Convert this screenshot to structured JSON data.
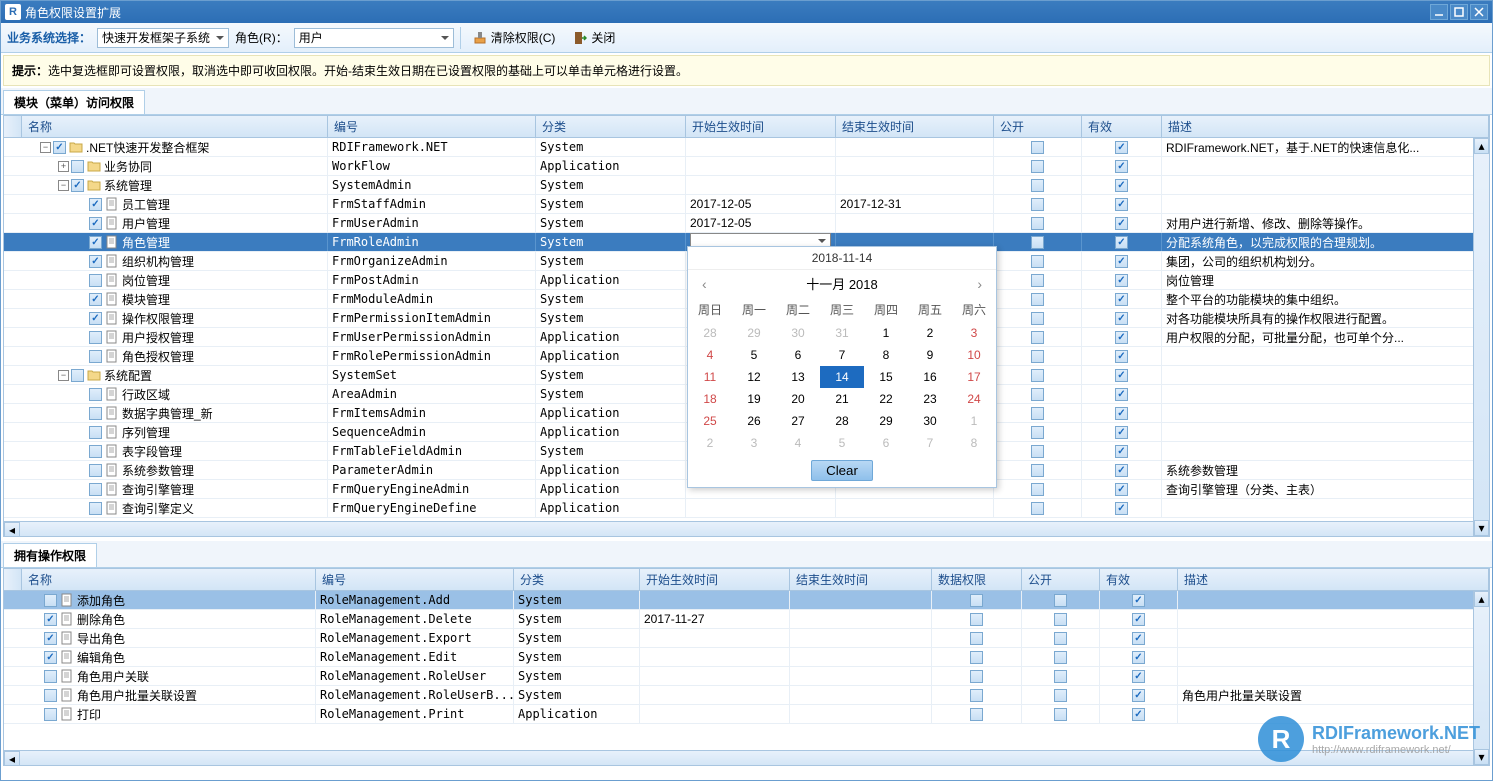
{
  "window": {
    "title": "角色权限设置扩展",
    "iconLetter": "R"
  },
  "toolbar": {
    "systemLabel": "业务系统选择：",
    "systemValue": "快速开发框架子系统",
    "roleLabel": "角色(R)：",
    "roleValue": "用户",
    "clearPerm": "清除权限(C)",
    "close": "关闭"
  },
  "tip": {
    "label": "提示：",
    "text": "选中复选框即可设置权限，取消选中即可收回权限。开始-结束生效日期在已设置权限的基础上可以单击单元格进行设置。"
  },
  "section1": {
    "tab": "模块（菜单）访问权限",
    "cols": {
      "name": "名称",
      "code": "编号",
      "cat": "分类",
      "start": "开始生效时间",
      "end": "结束生效时间",
      "pub": "公开",
      "valid": "有效",
      "desc": "描述"
    },
    "rows": [
      {
        "lvl": 0,
        "exp": "-",
        "chk": true,
        "name": ".NET快速开发整合框架",
        "code": "RDIFramework.NET",
        "cat": "System",
        "start": "",
        "end": "",
        "pub": false,
        "valid": true,
        "desc": "RDIFramework.NET，基于.NET的快速信息化..."
      },
      {
        "lvl": 1,
        "exp": "+",
        "chk": false,
        "name": "业务协同",
        "code": "WorkFlow",
        "cat": "Application",
        "start": "",
        "end": "",
        "pub": false,
        "valid": true,
        "desc": ""
      },
      {
        "lvl": 1,
        "exp": "-",
        "chk": true,
        "name": "系统管理",
        "code": "SystemAdmin",
        "cat": "System",
        "start": "",
        "end": "",
        "pub": false,
        "valid": true,
        "desc": ""
      },
      {
        "lvl": 2,
        "exp": "",
        "chk": true,
        "name": "员工管理",
        "code": "FrmStaffAdmin",
        "cat": "System",
        "start": "2017-12-05",
        "end": "2017-12-31",
        "pub": false,
        "valid": true,
        "desc": ""
      },
      {
        "lvl": 2,
        "exp": "",
        "chk": true,
        "name": "用户管理",
        "code": "FrmUserAdmin",
        "cat": "System",
        "start": "2017-12-05",
        "end": "",
        "pub": false,
        "valid": true,
        "desc": "对用户进行新增、修改、删除等操作。"
      },
      {
        "lvl": 2,
        "exp": "",
        "chk": true,
        "name": "角色管理",
        "code": "FrmRoleAdmin",
        "cat": "System",
        "start": "",
        "end": "",
        "pub": false,
        "valid": true,
        "desc": "分配系统角色，以完成权限的合理规划。",
        "sel": true,
        "dropdown": true
      },
      {
        "lvl": 2,
        "exp": "",
        "chk": true,
        "name": "组织机构管理",
        "code": "FrmOrganizeAdmin",
        "cat": "System",
        "start": "",
        "end": "",
        "pub": false,
        "valid": true,
        "desc": "集团，公司的组织机构划分。"
      },
      {
        "lvl": 2,
        "exp": "",
        "chk": false,
        "name": "岗位管理",
        "code": "FrmPostAdmin",
        "cat": "Application",
        "start": "",
        "end": "",
        "pub": false,
        "valid": true,
        "desc": "岗位管理"
      },
      {
        "lvl": 2,
        "exp": "",
        "chk": true,
        "name": "模块管理",
        "code": "FrmModuleAdmin",
        "cat": "System",
        "start": "",
        "end": "",
        "pub": false,
        "valid": true,
        "desc": "整个平台的功能模块的集中组织。"
      },
      {
        "lvl": 2,
        "exp": "",
        "chk": true,
        "name": "操作权限管理",
        "code": "FrmPermissionItemAdmin",
        "cat": "System",
        "start": "",
        "end": "",
        "pub": false,
        "valid": true,
        "desc": "对各功能模块所具有的操作权限进行配置。"
      },
      {
        "lvl": 2,
        "exp": "",
        "chk": false,
        "name": "用户授权管理",
        "code": "FrmUserPermissionAdmin",
        "cat": "Application",
        "start": "",
        "end": "",
        "pub": false,
        "valid": true,
        "desc": "用户权限的分配，可批量分配，也可单个分..."
      },
      {
        "lvl": 2,
        "exp": "",
        "chk": false,
        "name": "角色授权管理",
        "code": "FrmRolePermissionAdmin",
        "cat": "Application",
        "start": "",
        "end": "",
        "pub": false,
        "valid": true,
        "desc": ""
      },
      {
        "lvl": 1,
        "exp": "-",
        "chk": false,
        "name": "系统配置",
        "code": "SystemSet",
        "cat": "System",
        "start": "",
        "end": "",
        "pub": false,
        "valid": true,
        "desc": ""
      },
      {
        "lvl": 2,
        "exp": "",
        "chk": false,
        "name": "行政区域",
        "code": "AreaAdmin",
        "cat": "System",
        "start": "",
        "end": "",
        "pub": false,
        "valid": true,
        "desc": ""
      },
      {
        "lvl": 2,
        "exp": "",
        "chk": false,
        "name": "数据字典管理_新",
        "code": "FrmItemsAdmin",
        "cat": "Application",
        "start": "",
        "end": "",
        "pub": false,
        "valid": true,
        "desc": ""
      },
      {
        "lvl": 2,
        "exp": "",
        "chk": false,
        "name": "序列管理",
        "code": "SequenceAdmin",
        "cat": "Application",
        "start": "",
        "end": "",
        "pub": false,
        "valid": true,
        "desc": ""
      },
      {
        "lvl": 2,
        "exp": "",
        "chk": false,
        "name": "表字段管理",
        "code": "FrmTableFieldAdmin",
        "cat": "System",
        "start": "",
        "end": "",
        "pub": false,
        "valid": true,
        "desc": ""
      },
      {
        "lvl": 2,
        "exp": "",
        "chk": false,
        "name": "系统参数管理",
        "code": "ParameterAdmin",
        "cat": "Application",
        "start": "",
        "end": "",
        "pub": false,
        "valid": true,
        "desc": "系统参数管理"
      },
      {
        "lvl": 2,
        "exp": "",
        "chk": false,
        "name": "查询引擎管理",
        "code": "FrmQueryEngineAdmin",
        "cat": "Application",
        "start": "",
        "end": "",
        "pub": false,
        "valid": true,
        "desc": "查询引擎管理（分类、主表）"
      },
      {
        "lvl": 2,
        "exp": "",
        "chk": false,
        "name": "查询引擎定义",
        "code": "FrmQueryEngineDefine",
        "cat": "Application",
        "start": "",
        "end": "",
        "pub": false,
        "valid": true,
        "desc": ""
      }
    ]
  },
  "section2": {
    "tab": "拥有操作权限",
    "cols": {
      "name": "名称",
      "code": "编号",
      "cat": "分类",
      "start": "开始生效时间",
      "end": "结束生效时间",
      "data": "数据权限",
      "pub": "公开",
      "valid": "有效",
      "desc": "描述"
    },
    "rows": [
      {
        "chk": false,
        "name": "添加角色",
        "code": "RoleManagement.Add",
        "cat": "System",
        "start": "",
        "end": "",
        "data": false,
        "pub": false,
        "valid": true,
        "desc": "",
        "sel": true
      },
      {
        "chk": true,
        "name": "删除角色",
        "code": "RoleManagement.Delete",
        "cat": "System",
        "start": "2017-11-27",
        "end": "",
        "data": false,
        "pub": false,
        "valid": true,
        "desc": ""
      },
      {
        "chk": true,
        "name": "导出角色",
        "code": "RoleManagement.Export",
        "cat": "System",
        "start": "",
        "end": "",
        "data": false,
        "pub": false,
        "valid": true,
        "desc": ""
      },
      {
        "chk": true,
        "name": "编辑角色",
        "code": "RoleManagement.Edit",
        "cat": "System",
        "start": "",
        "end": "",
        "data": false,
        "pub": false,
        "valid": true,
        "desc": ""
      },
      {
        "chk": false,
        "name": "角色用户关联",
        "code": "RoleManagement.RoleUser",
        "cat": "System",
        "start": "",
        "end": "",
        "data": false,
        "pub": false,
        "valid": true,
        "desc": ""
      },
      {
        "chk": false,
        "name": "角色用户批量关联设置",
        "code": "RoleManagement.RoleUserB...",
        "cat": "System",
        "start": "",
        "end": "",
        "data": false,
        "pub": false,
        "valid": true,
        "desc": "角色用户批量关联设置"
      },
      {
        "chk": false,
        "name": "打印",
        "code": "RoleManagement.Print",
        "cat": "Application",
        "start": "",
        "end": "",
        "data": false,
        "pub": false,
        "valid": true,
        "desc": ""
      }
    ]
  },
  "datepicker": {
    "today": "2018-11-14",
    "monthLabel": "十一月 2018",
    "weekdays": [
      "周日",
      "周一",
      "周二",
      "周三",
      "周四",
      "周五",
      "周六"
    ],
    "clear": "Clear",
    "days": [
      {
        "n": "28",
        "o": true
      },
      {
        "n": "29",
        "o": true
      },
      {
        "n": "30",
        "o": true
      },
      {
        "n": "31",
        "o": true
      },
      {
        "n": "1"
      },
      {
        "n": "2"
      },
      {
        "n": "3",
        "s": true
      },
      {
        "n": "4",
        "s": true
      },
      {
        "n": "5"
      },
      {
        "n": "6"
      },
      {
        "n": "7"
      },
      {
        "n": "8"
      },
      {
        "n": "9"
      },
      {
        "n": "10",
        "s": true
      },
      {
        "n": "11",
        "s": true
      },
      {
        "n": "12"
      },
      {
        "n": "13"
      },
      {
        "n": "14",
        "sel": true
      },
      {
        "n": "15"
      },
      {
        "n": "16"
      },
      {
        "n": "17",
        "s": true
      },
      {
        "n": "18",
        "s": true
      },
      {
        "n": "19"
      },
      {
        "n": "20"
      },
      {
        "n": "21"
      },
      {
        "n": "22"
      },
      {
        "n": "23"
      },
      {
        "n": "24",
        "s": true
      },
      {
        "n": "25",
        "s": true
      },
      {
        "n": "26"
      },
      {
        "n": "27"
      },
      {
        "n": "28"
      },
      {
        "n": "29"
      },
      {
        "n": "30"
      },
      {
        "n": "1",
        "o": true
      },
      {
        "n": "2",
        "o": true
      },
      {
        "n": "3",
        "o": true
      },
      {
        "n": "4",
        "o": true
      },
      {
        "n": "5",
        "o": true
      },
      {
        "n": "6",
        "o": true
      },
      {
        "n": "7",
        "o": true
      },
      {
        "n": "8",
        "o": true
      }
    ]
  },
  "watermark": {
    "brand": "RDIFramework.NET",
    "url": "http://www.rdiframework.net/"
  }
}
